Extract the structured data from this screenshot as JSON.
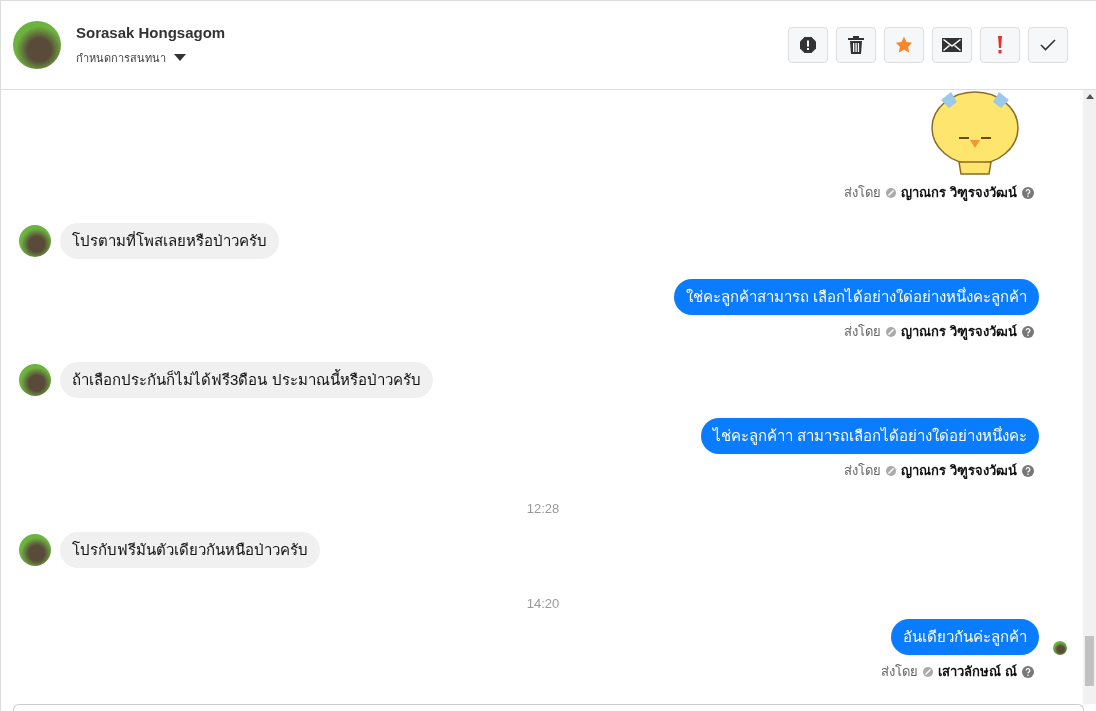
{
  "header": {
    "name": "Sorasak Hongsagom",
    "assign_label": "กำหนดการสนทนา",
    "buttons": [
      {
        "kind": "alert"
      },
      {
        "kind": "trash"
      },
      {
        "kind": "star"
      },
      {
        "kind": "mail"
      },
      {
        "kind": "important"
      },
      {
        "kind": "done"
      }
    ]
  },
  "messages": [
    {
      "kind": "sticker",
      "sent_by_label": "ส่งโดย",
      "sender": "ญาณกร วิฑูรจงวัฒน์"
    },
    {
      "kind": "incoming",
      "text": "โปรตามที่โพสเลยหรือป่าวครับ"
    },
    {
      "kind": "outgoing",
      "text": "ใช่คะลูกค้าสามารถ เลือกได้อย่างใด่อย่างหนึ่งคะลูกค้า",
      "sent_by_label": "ส่งโดย",
      "sender": "ญาณกร วิฑูรจงวัฒน์",
      "seen": false
    },
    {
      "kind": "incoming",
      "text": "ถ้าเลือกประกันก็ไม่ได้ฟรี3ดือน ประมาณนี้หรือป่าวครับ"
    },
    {
      "kind": "outgoing",
      "text": "ไช่คะลูกค้าา สามารถเลือกได้อย่างใด่อย่างหนึ่งคะ",
      "sent_by_label": "ส่งโดย",
      "sender": "ญาณกร วิฑูรจงวัฒน์",
      "seen": false
    },
    {
      "kind": "time",
      "text": "12:28"
    },
    {
      "kind": "incoming",
      "text": "โปรกับฟรีมันตัวเดียวกันหนือป่าวครับ"
    },
    {
      "kind": "time",
      "text": "14:20"
    },
    {
      "kind": "outgoing",
      "text": "อันเดียวกันค่ะลูกค้า",
      "sent_by_label": "ส่งโดย",
      "sender": "เสาวลักษณ์ ณ์",
      "seen": true
    }
  ]
}
